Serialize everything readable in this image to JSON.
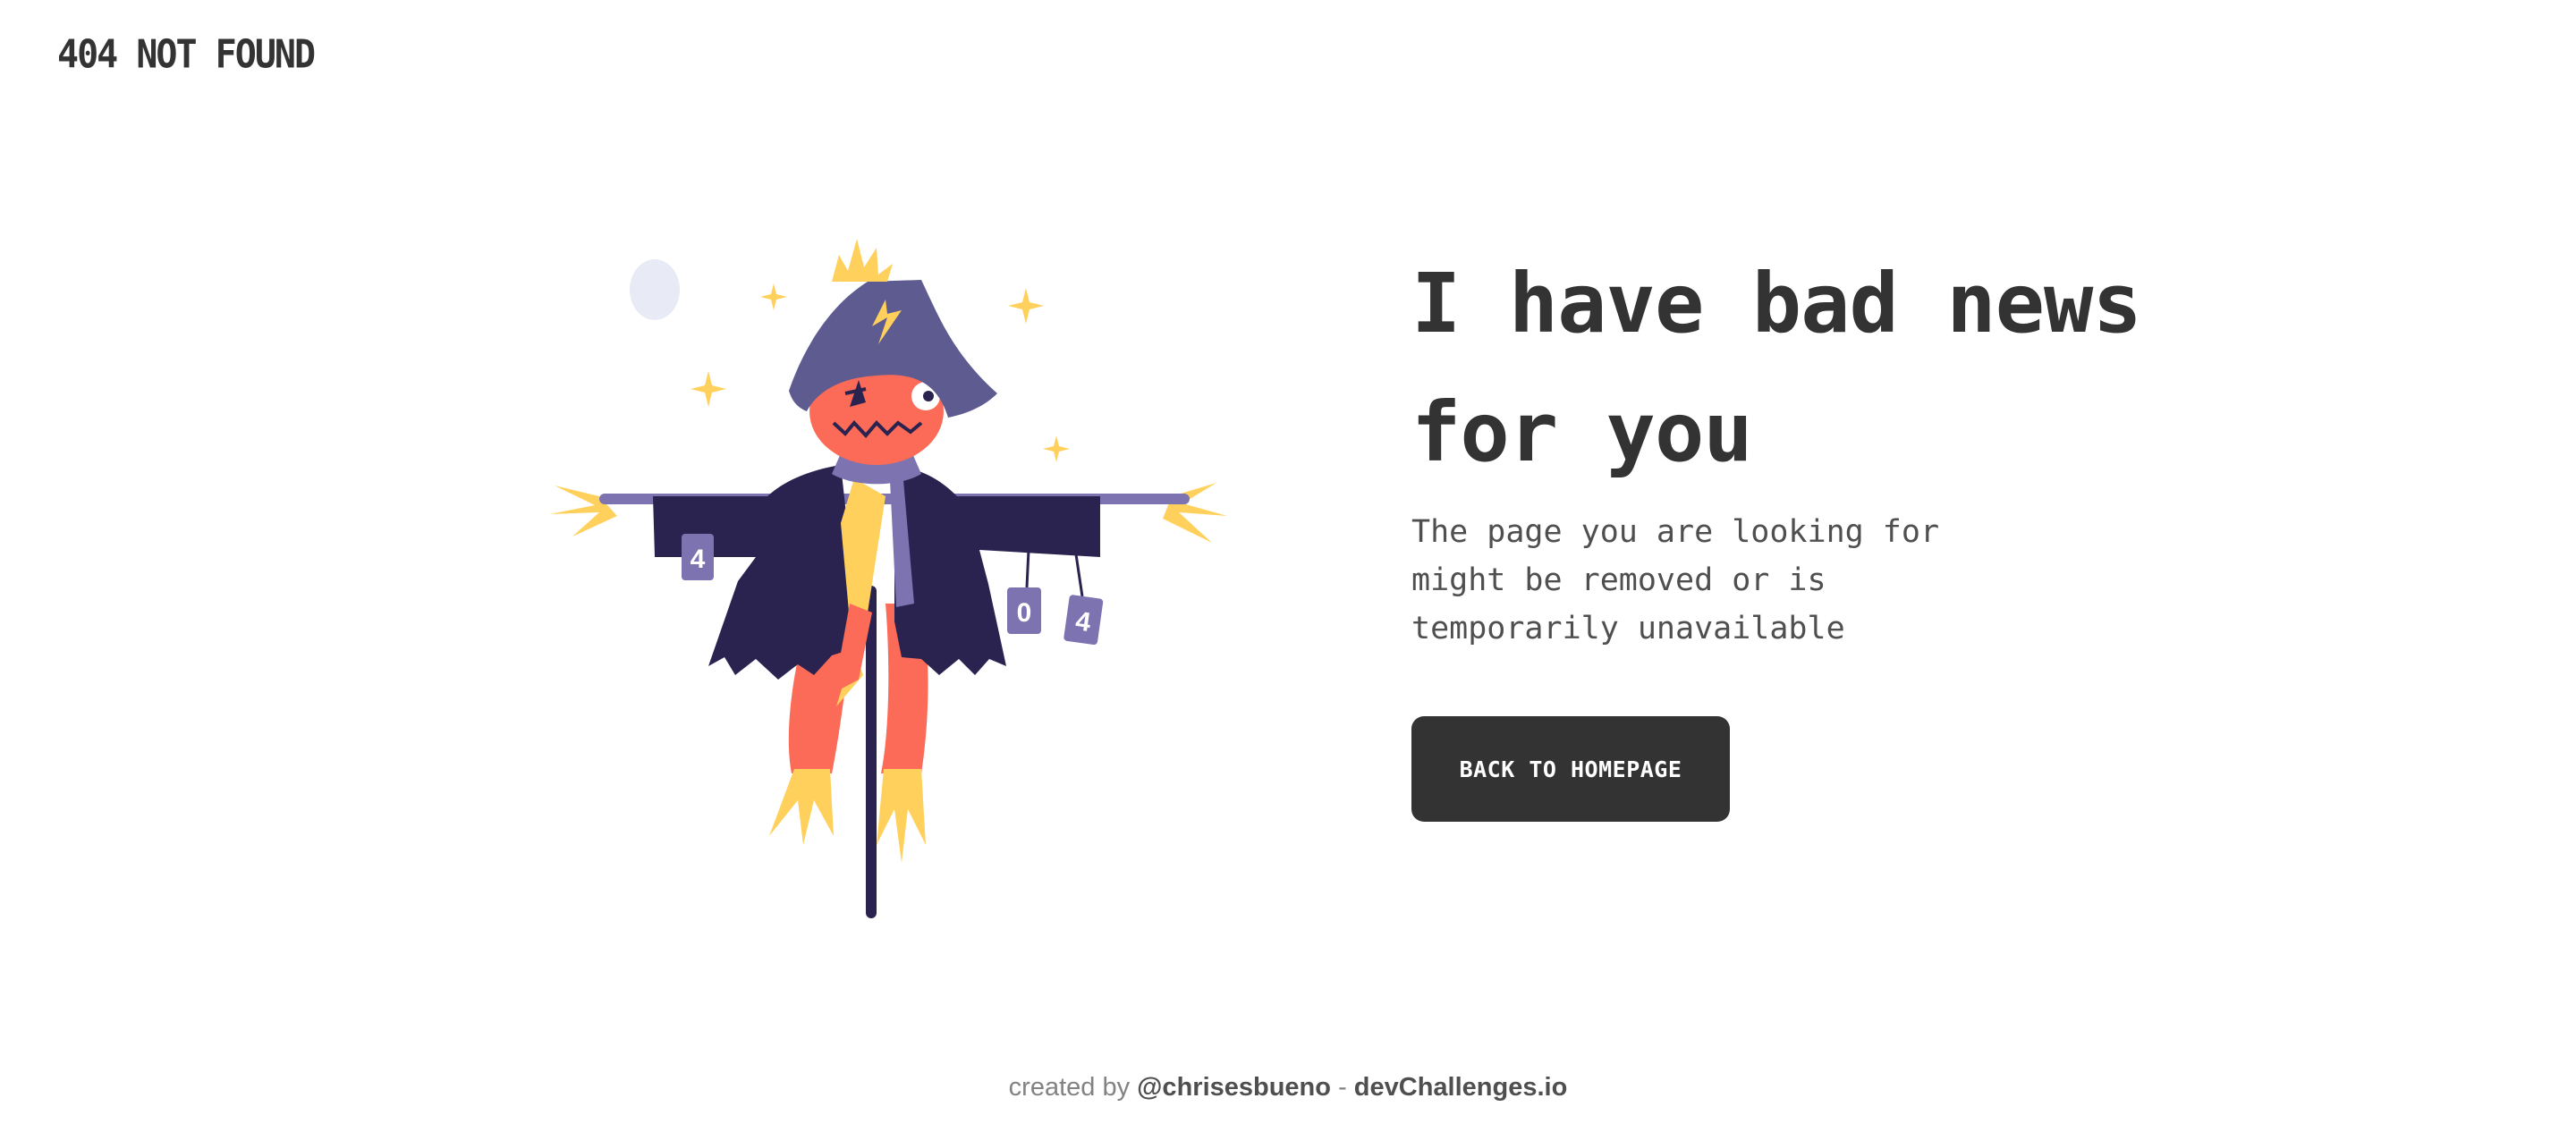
{
  "header": {
    "brand": "404 NOT FOUND"
  },
  "illustration": {
    "subject": "scarecrow",
    "can_labels": [
      "4",
      "0",
      "4"
    ],
    "colors": {
      "hat": "#5e5b91",
      "coat": "#2a2350",
      "face": "#fc6b57",
      "straw": "#ffd15c",
      "scarf": "#7c73b0",
      "moon": "#e8ebf5",
      "pole": "#2a2350"
    }
  },
  "main": {
    "headline": "I have bad news for you",
    "description": "The page you are looking for might be removed or is temporarily unavailable",
    "cta_label": "BACK TO HOMEPAGE"
  },
  "footer": {
    "created_by": "created by",
    "author": "@chrisesbueno",
    "separator": "-",
    "site": "devChallenges.io"
  }
}
